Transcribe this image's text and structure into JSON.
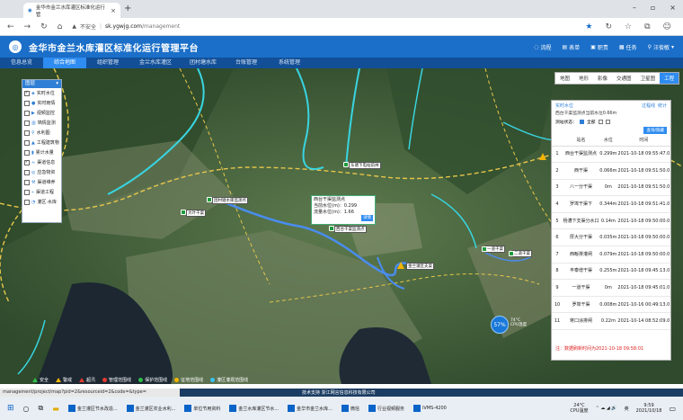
{
  "browser": {
    "tab_title": "金华市金兰水库灌区标准化运行管",
    "url_warning": "不安全",
    "url_host": "sk.ygwjg.com",
    "url_path": "/management"
  },
  "app": {
    "title": "金华市金兰水库灌区标准化运行管理平台",
    "header_links": [
      "流程",
      "表单",
      "职责",
      "任务",
      "汪俊敏"
    ],
    "nav": [
      "信息总览",
      "综合地图",
      "组织管理",
      "金兰水库灌区",
      "团村塘水库",
      "台账管理",
      "系统管理"
    ],
    "active_nav": "综合地图"
  },
  "layers": {
    "title": "图层",
    "items": [
      {
        "label": "实时水位",
        "checked": true
      },
      {
        "label": "实时雨情",
        "checked": false
      },
      {
        "label": "视频监控",
        "checked": false
      },
      {
        "label": "墒情监测",
        "checked": false
      },
      {
        "label": "水利图",
        "checked": false
      },
      {
        "label": "工程建筑物",
        "checked": false
      },
      {
        "label": "累计水量",
        "checked": false
      },
      {
        "label": "渠道信息",
        "checked": true
      },
      {
        "label": "应急物资",
        "checked": false
      },
      {
        "label": "渠道维养",
        "checked": false
      },
      {
        "label": "渠道工程",
        "checked": false
      },
      {
        "label": "灌区·水库",
        "checked": false
      }
    ]
  },
  "map_types": [
    "地图",
    "地形",
    "影像",
    "交通图",
    "卫星图",
    "工程"
  ],
  "map_labels": [
    "东塘下电站前闸",
    "团村塘水库监测点",
    "大叶干渠",
    "西台干渠监测点",
    "金兰灌区支渠",
    "一道干渠",
    "二道干渠"
  ],
  "popup": {
    "title": "西台干渠监测点",
    "line1": "当前水位(m)：0.299",
    "line2": "流量水位(m)：1.66",
    "button": "详情"
  },
  "panel": {
    "title": "实时水位",
    "links": [
      "过程线",
      "统计"
    ],
    "subtitle": "西台干渠监测点当前水位0.66m",
    "filter_label": "测站状态：",
    "filter_all": "全部",
    "query_button": "查询/隐藏",
    "columns": [
      "站名",
      "水位",
      "时间"
    ],
    "rows": [
      {
        "no": "1",
        "name": "西台干渠监测点",
        "level": "0.299m",
        "time": "2021-10-18 09:55:47.0"
      },
      {
        "no": "2",
        "name": "西干渠",
        "level": "0.066m",
        "time": "2021-10-18 09:51:50.0"
      },
      {
        "no": "3",
        "name": "八一分干渠",
        "level": "0m",
        "time": "2021-10-18 09:51:50.0"
      },
      {
        "no": "4",
        "name": "罗埠干渠下",
        "level": "0.344m",
        "time": "2021-10-18 09:51:41.0"
      },
      {
        "no": "5",
        "name": "杨漕下支渠分水口",
        "level": "0.14m",
        "time": "2021-10-18 09:50:00.0"
      },
      {
        "no": "6",
        "name": "厚大分干渠",
        "level": "0.035m",
        "time": "2021-10-18 09:50:00.0"
      },
      {
        "no": "7",
        "name": "西畈排灌闸",
        "level": "0.079m",
        "time": "2021-10-18 09:50:00.0"
      },
      {
        "no": "8",
        "name": "丰泰增干渠",
        "level": "0.255m",
        "time": "2021-10-18 09:45:13.0"
      },
      {
        "no": "9",
        "name": "一道干渠",
        "level": "0m",
        "time": "2021-10-18 09:45:01.0"
      },
      {
        "no": "10",
        "name": "罗埠干渠",
        "level": "0.008m",
        "time": "2021-10-16 00:49:13.0"
      },
      {
        "no": "11",
        "name": "蒋口涂排闸",
        "level": "0.22m",
        "time": "2021-10-14 08:52:09.0"
      }
    ],
    "footer": "注：数据刷新时间为2021-10-18 09:58:01"
  },
  "legend": [
    {
      "label": "安全",
      "color": "#2fbf4a",
      "shape": "tri"
    },
    {
      "label": "警戒",
      "color": "#f5b400",
      "shape": "tri"
    },
    {
      "label": "超汛",
      "color": "#e23b2e",
      "shape": "tri"
    },
    {
      "label": "管理范围线",
      "color": "#e23b2e",
      "shape": "dot"
    },
    {
      "label": "保护范围线",
      "color": "#2fbf4a",
      "shape": "dot"
    },
    {
      "label": "征地范围线",
      "color": "#f5b400",
      "shape": "dot"
    },
    {
      "label": "灌区灌溉范围线",
      "color": "#39c2f0",
      "shape": "dot"
    }
  ],
  "speed": {
    "value": "57%",
    "up": "74°C",
    "down": "CPU温度"
  },
  "status": {
    "url": "management/project/map?pid=2&resourceid=2&code=&type=",
    "support": "技术支持 浙江网言信息科技有限公司"
  },
  "taskbar": {
    "apps": [
      "金兰灌区节水改造...",
      "金兰灌区农业水利...",
      "单位节用资料",
      "金兰水库灌区节水...",
      "金华市金兰水库...",
      "微信",
      "行业视频服务",
      "iVMS-4200"
    ],
    "weather": "24°C",
    "weather_sub": "CPU温度",
    "ime": "英",
    "time": "9:59",
    "date": "2021/10/18"
  },
  "colors": {
    "brand": "#1b6fc9",
    "nav": "#124f97",
    "accent": "#2f8cf0"
  }
}
